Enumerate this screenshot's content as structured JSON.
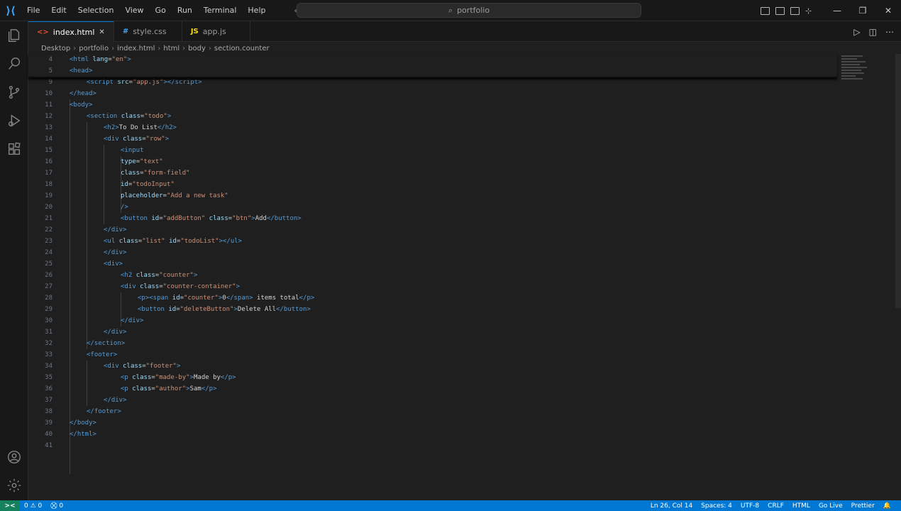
{
  "menu": [
    "File",
    "Edit",
    "Selection",
    "View",
    "Go",
    "Run",
    "Terminal",
    "Help"
  ],
  "search": {
    "label": "portfolio"
  },
  "tabs": [
    {
      "label": "index.html",
      "icon": "html-icon",
      "active": true
    },
    {
      "label": "style.css",
      "icon": "css-icon",
      "active": false
    },
    {
      "label": "app.js",
      "icon": "js-icon",
      "active": false
    }
  ],
  "breadcrumb": [
    "Desktop",
    "portfolio",
    "index.html",
    "html",
    "body",
    "section.counter"
  ],
  "code_lines": [
    {
      "n": "4",
      "indent": 0,
      "html": "<span class='t-tag'>&lt;html</span> <span class='t-attr'>lang</span>=<span class='t-str'>\"en\"</span><span class='t-tag'>&gt;</span>"
    },
    {
      "n": "5",
      "indent": 0,
      "html": "<span class='t-tag'>&lt;head&gt;</span>"
    },
    {
      "n": "9",
      "indent": 1,
      "html": "<span class='t-tag'>&lt;script</span> <span class='t-attr'>src</span>=<span class='t-str'>\"app.js\"</span><span class='t-tag'>&gt;&lt;/script&gt;</span>"
    },
    {
      "n": "10",
      "indent": 0,
      "html": "<span class='t-tag'>&lt;/head&gt;</span>"
    },
    {
      "n": "11",
      "indent": 0,
      "html": "<span class='t-tag'>&lt;body&gt;</span>"
    },
    {
      "n": "12",
      "indent": 1,
      "html": "<span class='t-tag'>&lt;section</span> <span class='t-attr'>class</span>=<span class='t-str'>\"todo\"</span><span class='t-tag'>&gt;</span>"
    },
    {
      "n": "13",
      "indent": 2,
      "html": "<span class='t-tag'>&lt;h2&gt;</span><span class='t-txt'>To Do List</span><span class='t-tag'>&lt;/h2&gt;</span>"
    },
    {
      "n": "14",
      "indent": 2,
      "html": "<span class='t-tag'>&lt;div</span> <span class='t-attr'>class</span>=<span class='t-str'>\"row\"</span><span class='t-tag'>&gt;</span>"
    },
    {
      "n": "15",
      "indent": 3,
      "html": "<span class='t-tag'>&lt;input</span>"
    },
    {
      "n": "16",
      "indent": 3,
      "html": "<span class='t-attr'>type</span>=<span class='t-str'>\"text\"</span>"
    },
    {
      "n": "17",
      "indent": 3,
      "html": "<span class='t-attr'>class</span>=<span class='t-str'>\"form-field\"</span>"
    },
    {
      "n": "18",
      "indent": 3,
      "html": "<span class='t-attr'>id</span>=<span class='t-str'>\"todoInput\"</span>"
    },
    {
      "n": "19",
      "indent": 3,
      "html": "<span class='t-attr'>placeholder</span>=<span class='t-str'>\"Add a new task\"</span>"
    },
    {
      "n": "20",
      "indent": 3,
      "html": "<span class='t-tag'>/&gt;</span>"
    },
    {
      "n": "21",
      "indent": 3,
      "html": "<span class='t-tag'>&lt;button</span> <span class='t-attr'>id</span>=<span class='t-str'>\"addButton\"</span> <span class='t-attr'>class</span>=<span class='t-str'>\"btn\"</span><span class='t-tag'>&gt;</span><span class='t-txt'>Add</span><span class='t-tag'>&lt;/button&gt;</span>"
    },
    {
      "n": "22",
      "indent": 2,
      "html": "<span class='t-tag'>&lt;/div&gt;</span>"
    },
    {
      "n": "23",
      "indent": 2,
      "html": "<span class='t-tag'>&lt;ul</span> <span class='t-attr'>class</span>=<span class='t-str'>\"list\"</span> <span class='t-attr'>id</span>=<span class='t-str'>\"todoList\"</span><span class='t-tag'>&gt;&lt;/ul&gt;</span>"
    },
    {
      "n": "24",
      "indent": 2,
      "html": "<span class='t-tag'>&lt;/div&gt;</span>"
    },
    {
      "n": "25",
      "indent": 2,
      "html": "<span class='t-tag'>&lt;div&gt;</span>"
    },
    {
      "n": "26",
      "indent": 3,
      "html": "<span class='t-tag'>&lt;h2</span> <span class='t-attr'>class</span>=<span class='t-str'>\"counter\"</span><span class='t-tag'>&gt;</span>"
    },
    {
      "n": "27",
      "indent": 3,
      "html": "<span class='t-tag'>&lt;div</span> <span class='t-attr'>class</span>=<span class='t-str'>\"counter-container\"</span><span class='t-tag'>&gt;</span>"
    },
    {
      "n": "28",
      "indent": 4,
      "html": "<span class='t-tag'>&lt;p&gt;&lt;span</span> <span class='t-attr'>id</span>=<span class='t-str'>\"counter\"</span><span class='t-tag'>&gt;</span><span class='t-txt'>0</span><span class='t-tag'>&lt;/span&gt;</span><span class='t-txt'> items total</span><span class='t-tag'>&lt;/p&gt;</span>"
    },
    {
      "n": "29",
      "indent": 4,
      "html": "<span class='t-tag'>&lt;button</span> <span class='t-attr'>id</span>=<span class='t-str'>\"deleteButton\"</span><span class='t-tag'>&gt;</span><span class='t-txt'>Delete All</span><span class='t-tag'>&lt;/button&gt;</span>"
    },
    {
      "n": "30",
      "indent": 3,
      "html": "<span class='t-tag'>&lt;/div&gt;</span>"
    },
    {
      "n": "31",
      "indent": 2,
      "html": "<span class='t-tag'>&lt;/div&gt;</span>"
    },
    {
      "n": "32",
      "indent": 1,
      "html": "<span class='t-tag'>&lt;/section&gt;</span>"
    },
    {
      "n": "33",
      "indent": 1,
      "html": "<span class='t-tag'>&lt;footer&gt;</span>"
    },
    {
      "n": "34",
      "indent": 2,
      "html": "<span class='t-tag'>&lt;div</span> <span class='t-attr'>class</span>=<span class='t-str'>\"footer\"</span><span class='t-tag'>&gt;</span>"
    },
    {
      "n": "35",
      "indent": 3,
      "html": "<span class='t-tag'>&lt;p</span> <span class='t-attr'>class</span>=<span class='t-str'>\"made-by\"</span><span class='t-tag'>&gt;</span><span class='t-txt'>Made by</span><span class='t-tag'>&lt;/p&gt;</span>"
    },
    {
      "n": "36",
      "indent": 3,
      "html": "<span class='t-tag'>&lt;p</span> <span class='t-attr'>class</span>=<span class='t-str'>\"author\"</span><span class='t-tag'>&gt;</span><span class='t-txt'>Sam</span><span class='t-tag'>&lt;/p&gt;</span>"
    },
    {
      "n": "37",
      "indent": 2,
      "html": "<span class='t-tag'>&lt;/div&gt;</span>"
    },
    {
      "n": "38",
      "indent": 1,
      "html": "<span class='t-tag'>&lt;/footer&gt;</span>"
    },
    {
      "n": "39",
      "indent": 0,
      "html": "<span class='t-tag'>&lt;/body&gt;</span>"
    },
    {
      "n": "40",
      "indent": 0,
      "html": "<span class='t-tag'>&lt;/html&gt;</span>"
    },
    {
      "n": "41",
      "indent": 0,
      "html": ""
    }
  ],
  "statusbar": {
    "remote": "><",
    "errors": "0 ⚠ 0",
    "ports": "0",
    "right": [
      "Ln 26, Col 14",
      "Spaces: 4",
      "UTF-8",
      "CRLF",
      "HTML",
      "Go Live",
      "Prettier"
    ]
  },
  "colors": {
    "accent": "#0078d4",
    "tag": "#569cd6",
    "attr": "#9cdcfe",
    "string": "#ce9178"
  }
}
